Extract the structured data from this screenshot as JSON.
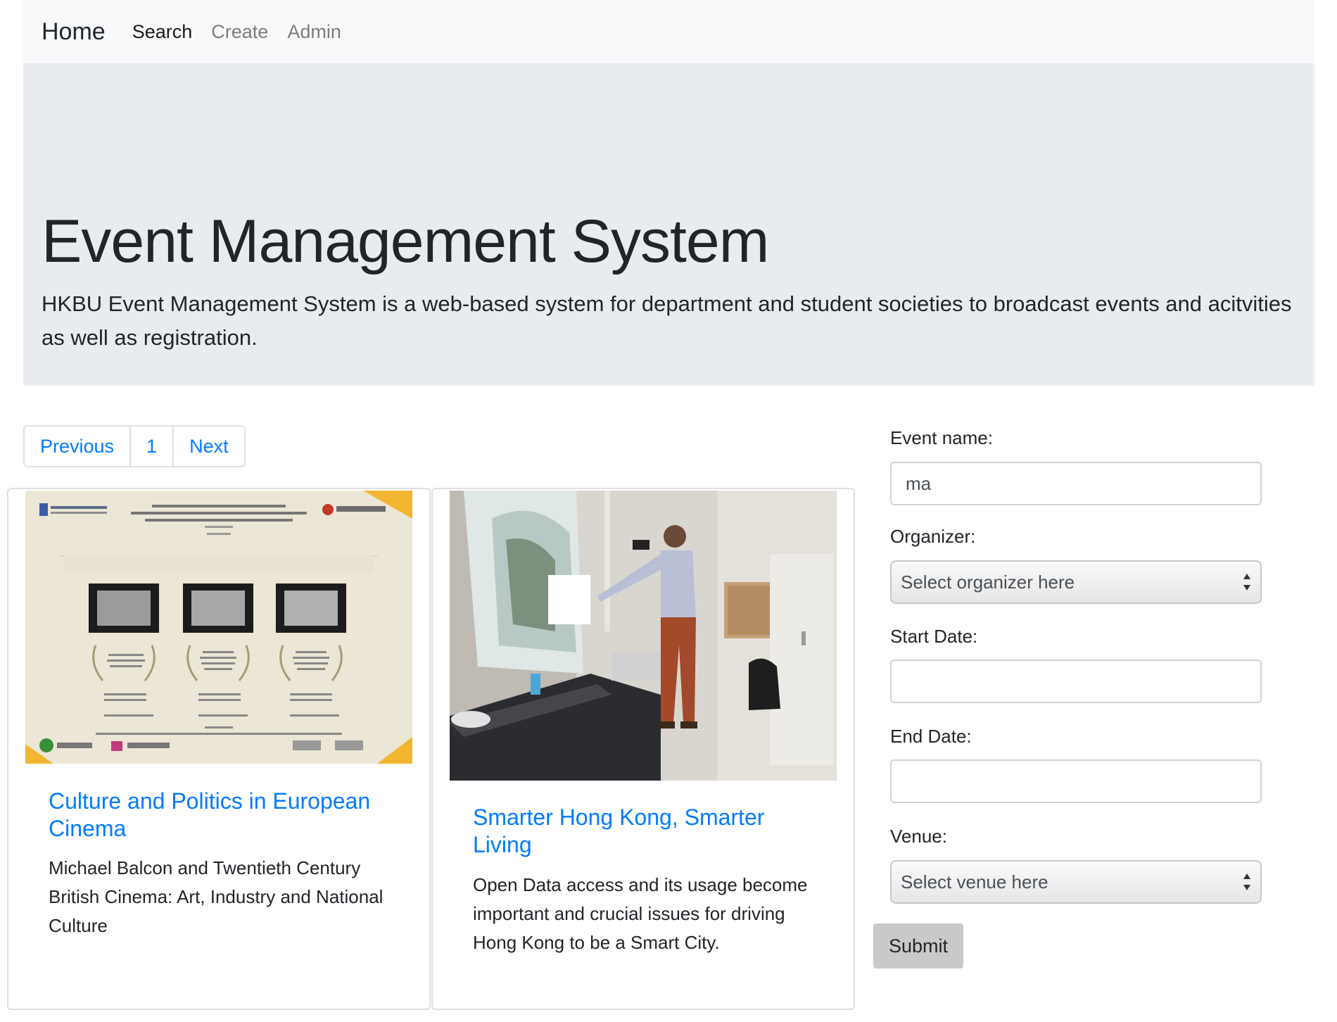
{
  "navbar": {
    "brand": "Home",
    "links": [
      "Search",
      "Create",
      "Admin"
    ]
  },
  "jumbotron": {
    "title": "Event Management System",
    "lead": "HKBU Event Management System is a web-based system for department and student societies to broadcast events and acitvities as well as registration."
  },
  "pagination": {
    "previous": "Previous",
    "current_page": "1",
    "next": "Next"
  },
  "events": [
    {
      "title": "Culture and Politics in European Cinema",
      "description": "Michael Balcon and Twentieth Century British Cinema: Art, Industry and National Culture",
      "image": "culture-politics-poster"
    },
    {
      "title": "Smarter Hong Kong, Smarter Living",
      "description": "Open Data access and its usage become important and crucial issues for driving Hong Kong to be a Smart City.",
      "image": "presenter-photo"
    }
  ],
  "search_form": {
    "event_name_label": "Event name:",
    "event_name_value": "ma",
    "organizer_label": "Organizer:",
    "organizer_placeholder": "Select organizer here",
    "start_date_label": "Start Date:",
    "start_date_value": "",
    "end_date_label": "End Date:",
    "end_date_value": "",
    "venue_label": "Venue:",
    "venue_placeholder": "Select venue here",
    "submit_label": "Submit"
  },
  "colors": {
    "link": "#007bff",
    "navbar_bg": "#f8f9fa",
    "jumbotron_bg": "#e9ecef",
    "submit_bg": "#c9c9c9"
  }
}
